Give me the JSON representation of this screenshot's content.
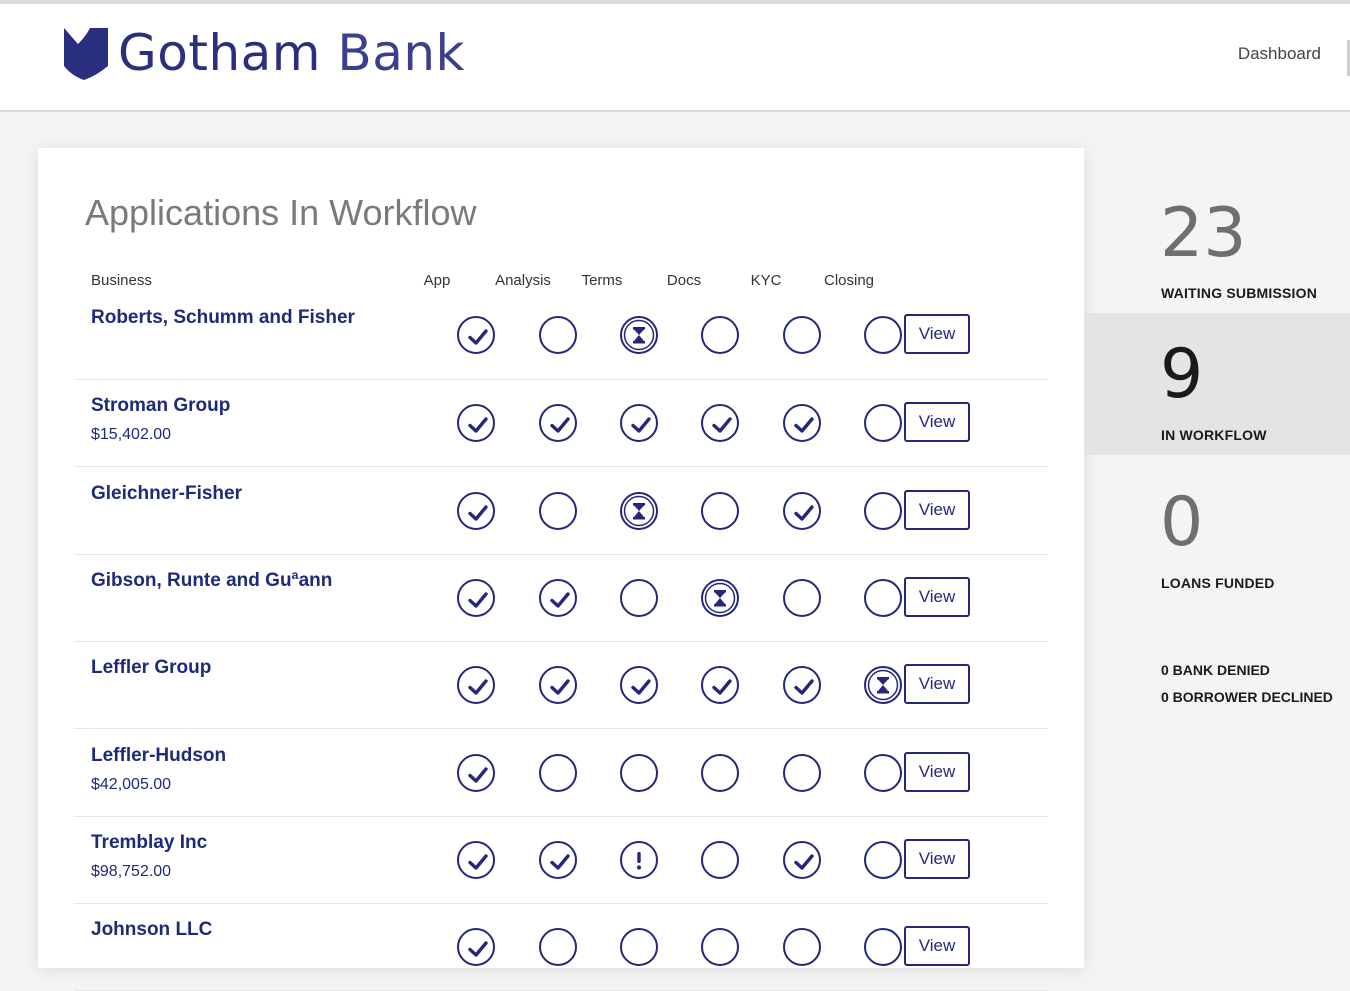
{
  "header": {
    "brand_part1": "Gotham",
    "brand_part2": "Bank",
    "nav_dashboard": "Dashboard",
    "brand_color": "#2b2f80"
  },
  "workflow": {
    "title": "Applications In Workflow",
    "columns": {
      "business": "Business",
      "stages": [
        "App",
        "Analysis",
        "Terms",
        "Docs",
        "KYC",
        "Closing"
      ]
    },
    "view_label": "View",
    "rows": [
      {
        "name": "Roberts, Schumm and Fisher",
        "amount": "",
        "statuses": [
          "done",
          "empty",
          "pending",
          "empty",
          "empty",
          "empty"
        ]
      },
      {
        "name": "Stroman Group",
        "amount": "$15,402.00",
        "statuses": [
          "done",
          "done",
          "done",
          "done",
          "done",
          "empty"
        ]
      },
      {
        "name": "Gleichner-Fisher",
        "amount": "",
        "statuses": [
          "done",
          "empty",
          "pending",
          "empty",
          "done",
          "empty"
        ]
      },
      {
        "name": "Gibson, Runte and Guªann",
        "amount": "",
        "statuses": [
          "done",
          "done",
          "empty",
          "pending",
          "empty",
          "empty"
        ]
      },
      {
        "name": "Leffler Group",
        "amount": "",
        "statuses": [
          "done",
          "done",
          "done",
          "done",
          "done",
          "pending"
        ]
      },
      {
        "name": "Leffler-Hudson",
        "amount": "$42,005.00",
        "statuses": [
          "done",
          "empty",
          "empty",
          "empty",
          "empty",
          "empty"
        ]
      },
      {
        "name": "Tremblay Inc",
        "amount": "$98,752.00",
        "statuses": [
          "done",
          "done",
          "alert",
          "empty",
          "done",
          "empty"
        ]
      },
      {
        "name": "Johnson LLC",
        "amount": "",
        "statuses": [
          "done",
          "empty",
          "empty",
          "empty",
          "empty",
          "empty"
        ]
      }
    ],
    "status_icons": {
      "done": "check-icon",
      "pending": "hourglass-icon",
      "alert": "exclamation-icon",
      "empty": "empty-circle-icon"
    },
    "accent_color": "#23287a"
  },
  "stats": {
    "waiting": {
      "value": "23",
      "label": "WAITING SUBMISSION"
    },
    "in_workflow": {
      "value": "9",
      "label": "IN WORKFLOW"
    },
    "funded": {
      "value": "0",
      "label": "LOANS FUNDED"
    },
    "bank_denied": "0 BANK DENIED",
    "borrower_declined": "0 BORROWER DECLINED"
  }
}
